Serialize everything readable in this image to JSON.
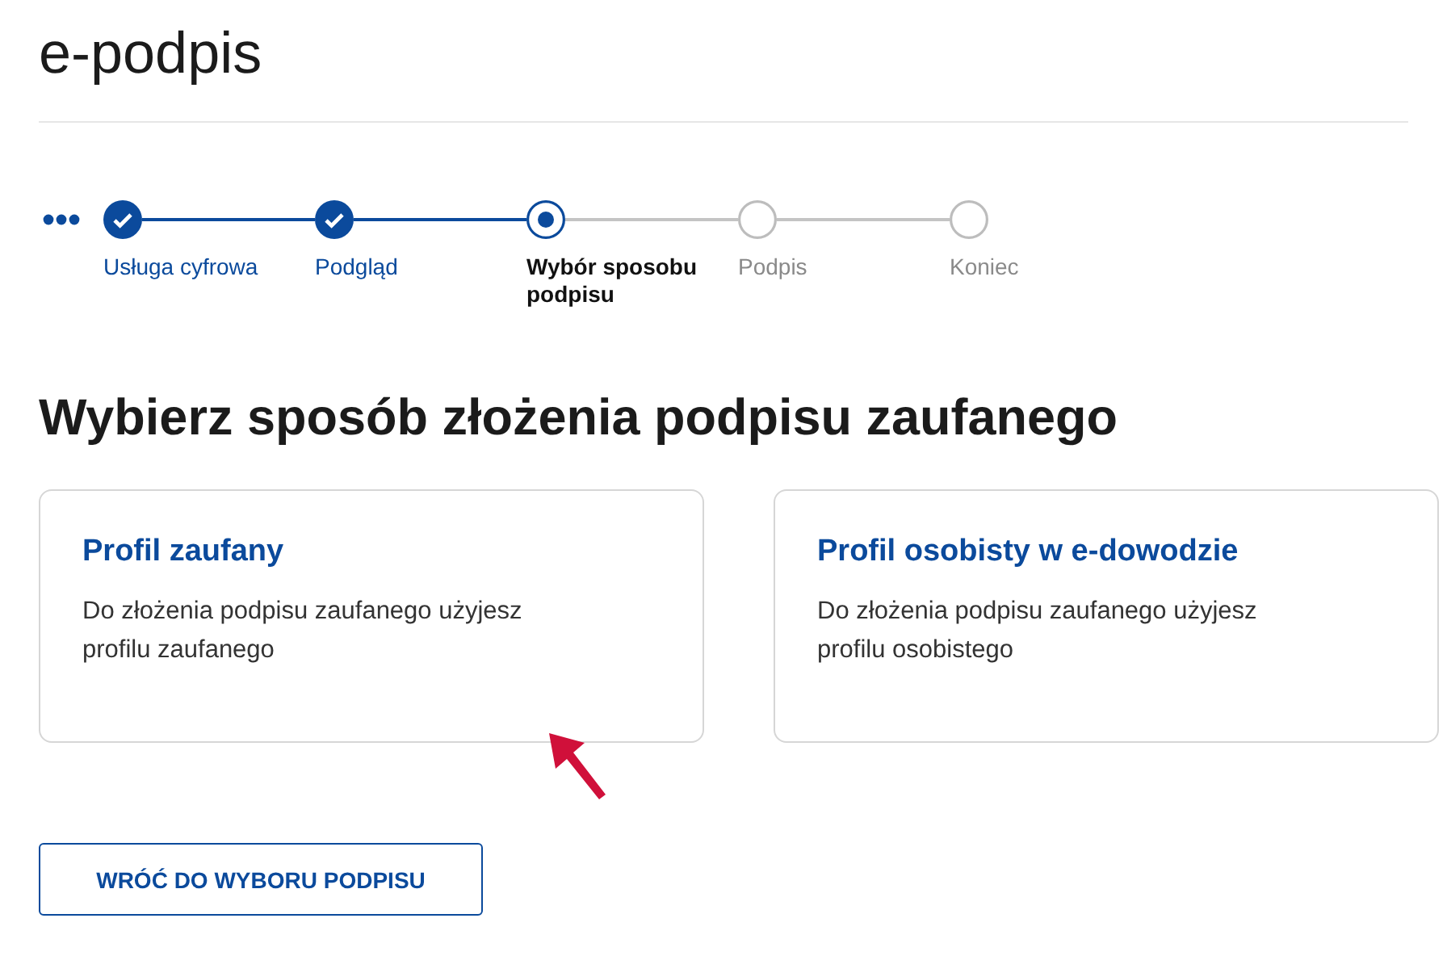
{
  "page_title": "e-podpis",
  "steps": [
    {
      "label": "Usługa cyfrowa",
      "kind": "done"
    },
    {
      "label": "Podgląd",
      "kind": "done"
    },
    {
      "label": "Wybór sposobu podpisu",
      "kind": "current"
    },
    {
      "label": "Podpis",
      "kind": "pending"
    },
    {
      "label": "Koniec",
      "kind": "pending"
    }
  ],
  "heading": "Wybierz sposób złożenia podpisu zaufanego",
  "options": [
    {
      "title": "Profil zaufany",
      "description": "Do złożenia podpisu zaufanego użyjesz profilu zaufanego"
    },
    {
      "title": "Profil osobisty w e-dowodzie",
      "description": "Do złożenia podpisu zaufanego użyjesz profilu osobistego"
    }
  ],
  "back_button": "WRÓĆ DO WYBORU PODPISU"
}
